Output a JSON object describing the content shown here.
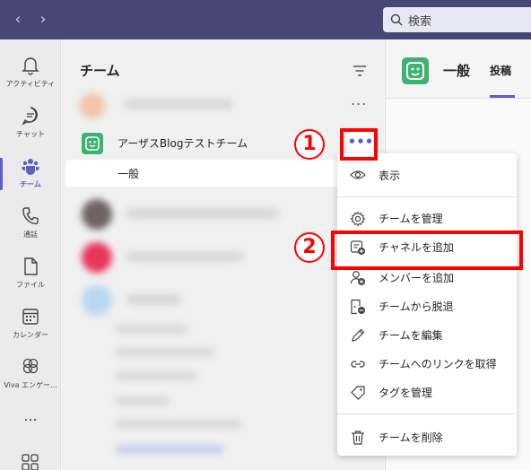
{
  "topbar": {
    "search_placeholder": "検索",
    "back_icon": "chevron-left-icon",
    "forward_icon": "chevron-right-icon"
  },
  "rail": {
    "items": [
      {
        "label": "アクティビティ",
        "icon": "bell-icon"
      },
      {
        "label": "チャット",
        "icon": "chat-icon"
      },
      {
        "label": "チーム",
        "icon": "teams-icon"
      },
      {
        "label": "通話",
        "icon": "phone-icon"
      },
      {
        "label": "ファイル",
        "icon": "file-icon"
      },
      {
        "label": "カレンダー",
        "icon": "calendar-icon"
      },
      {
        "label": "Viva エンゲー...",
        "icon": "viva-icon"
      }
    ],
    "more_label": "...",
    "accent": "#5b5fc7"
  },
  "pane": {
    "title": "チーム",
    "faint_more": "...",
    "team_name": "アーザスBlogテストチーム",
    "more_button": "•••",
    "channel_name": "一般"
  },
  "main": {
    "title": "一般",
    "tab": "投稿"
  },
  "menu": {
    "items": [
      {
        "label": "表示",
        "icon": "eye-icon"
      },
      {
        "label": "チームを管理",
        "icon": "gear-icon"
      },
      {
        "label": "チャネルを追加",
        "icon": "add-channel-icon"
      },
      {
        "label": "メンバーを追加",
        "icon": "add-member-icon"
      },
      {
        "label": "チームから脱退",
        "icon": "leave-icon"
      },
      {
        "label": "チームを編集",
        "icon": "pencil-icon"
      },
      {
        "label": "チームへのリンクを取得",
        "icon": "link-icon"
      },
      {
        "label": "タグを管理",
        "icon": "tag-icon"
      },
      {
        "label": "チームを削除",
        "icon": "trash-icon"
      }
    ]
  },
  "annotations": {
    "marker1": "1",
    "marker2": "2",
    "color": "#ff0000"
  }
}
